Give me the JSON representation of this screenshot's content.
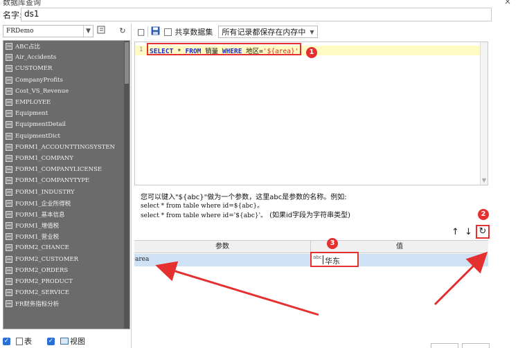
{
  "window": {
    "title": "数据库查询",
    "close_glyph": "×"
  },
  "name_field": {
    "label": "名字:",
    "value": "ds1"
  },
  "datasource": {
    "selected": "FRDemo"
  },
  "tables": [
    "ABC占比",
    "Air_Accidents",
    "CUSTOMER",
    "CompanyProfits",
    "Cost_VS_Revenue",
    "EMPLOYEE",
    "Equipment",
    "EquipmentDetail",
    "EquipmentDict",
    "FORM1_ACCOUNTTINGSYSTEN",
    "FORM1_COMPANY",
    "FORM1_COMPANYLICENSE",
    "FORM1_COMPANYTYPE",
    "FORM1_INDUSTRY",
    "FORM1_企业所得税",
    "FORM1_基本信息",
    "FORM1_增值税",
    "FORM1_营业税",
    "FORM2_CHANCE",
    "FORM2_CUSTOMER",
    "FORM2_ORDERS",
    "FORM2_PRODUCT",
    "FORM2_SERVICE",
    "FR财务指标分析"
  ],
  "filters": {
    "table_label": "表",
    "view_label": "视图"
  },
  "toolbar": {
    "share_label": "共享数据集",
    "save_mode": "所有记录都保存在内存中"
  },
  "editor": {
    "line_number": "1",
    "sql": [
      {
        "t": "SELECT",
        "k": "kw"
      },
      {
        "t": " * ",
        "k": "plain"
      },
      {
        "t": "FROM",
        "k": "kw"
      },
      {
        "t": " 销量 ",
        "k": "plain"
      },
      {
        "t": "WHERE",
        "k": "kw"
      },
      {
        "t": " 地区=",
        "k": "plain"
      },
      {
        "t": "'${area}'",
        "k": "str"
      }
    ]
  },
  "hint": {
    "line1": "您可以键入\"${abc}\"做为一个参数，这里abc是参数的名称。例如:",
    "line2": "select * from table where id=${abc}。",
    "line3_code": "select * from table where id='${abc}'。",
    "line3_note": "(如果id字段为字符串类型)"
  },
  "param_table": {
    "headers": [
      "参数",
      "值"
    ],
    "rows": [
      {
        "name": "area",
        "value": "华东"
      }
    ]
  },
  "value_type_icon": "abc",
  "annotations": [
    "1",
    "2",
    "3"
  ],
  "colors": {
    "annotation": "#e53030",
    "selected_row": "#cfe2f5",
    "keyword": "#1c2de0"
  }
}
